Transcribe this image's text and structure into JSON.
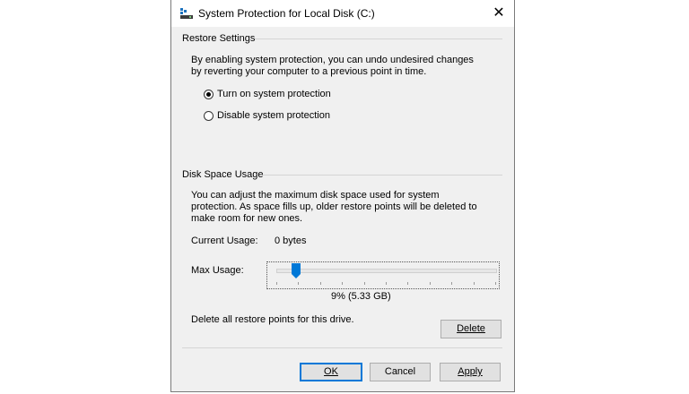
{
  "window": {
    "title": "System Protection for Local Disk (C:)",
    "app_icon": "system-protection-icon",
    "close_glyph": "✕"
  },
  "restore": {
    "heading": "Restore Settings",
    "description": "By enabling system protection, you can undo undesired changes by reverting your computer to a previous point in time.",
    "options": [
      {
        "label": "Turn on system protection",
        "checked": true
      },
      {
        "label": "Disable system protection",
        "checked": false
      }
    ]
  },
  "disk": {
    "heading": "Disk Space Usage",
    "description": "You can adjust the maximum disk space used for system protection. As space fills up, older restore points will be deleted to make room for new ones.",
    "current_usage_label": "Current Usage:",
    "current_usage_value": "0 bytes",
    "max_usage_label": "Max Usage:",
    "max_usage_percent": 9,
    "max_usage_readout": "9% (5.33 GB)",
    "delete_text": "Delete all restore points for this drive.",
    "delete_button": "Delete"
  },
  "footer": {
    "ok": "OK",
    "cancel": "Cancel",
    "apply": "Apply"
  },
  "colors": {
    "accent": "#0078d7",
    "dialog_bg": "#f0f0f0"
  }
}
